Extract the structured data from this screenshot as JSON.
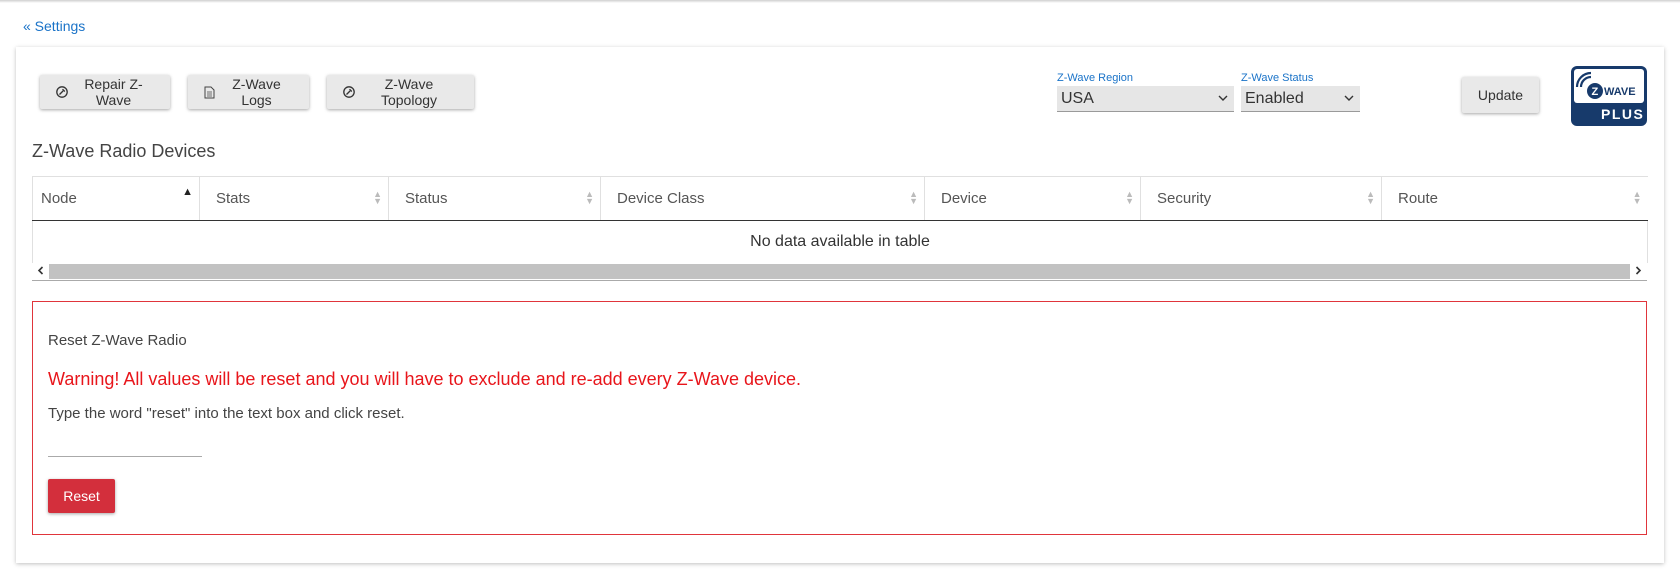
{
  "nav": {
    "back_label": "« Settings"
  },
  "toolbar": {
    "repair_label": "Repair Z-Wave",
    "logs_label": "Z-Wave Logs",
    "topology_label": "Z-Wave Topology",
    "update_label": "Update"
  },
  "region": {
    "label": "Z-Wave Region",
    "value": "USA"
  },
  "status": {
    "label": "Z-Wave Status",
    "value": "Enabled"
  },
  "logo": {
    "top_text": "WAVE",
    "letter": "Z",
    "bottom_text": "PLUS",
    "color": "#173a6b"
  },
  "devices": {
    "title": "Z-Wave Radio Devices",
    "columns": [
      "Node",
      "Stats",
      "Status",
      "Device Class",
      "Device",
      "Security",
      "Route"
    ],
    "sorted_column": "Node",
    "empty_text": "No data available in table"
  },
  "reset": {
    "title": "Reset Z-Wave Radio",
    "warning": "Warning! All values will be reset and you will have to exclude and re-add every Z-Wave device.",
    "instruction": "Type the word \"reset\" into the text box and click reset.",
    "input_value": "",
    "button_label": "Reset"
  },
  "colors": {
    "link": "#1a73c8",
    "danger": "#d32f3c",
    "warning_text": "#e8151b"
  }
}
